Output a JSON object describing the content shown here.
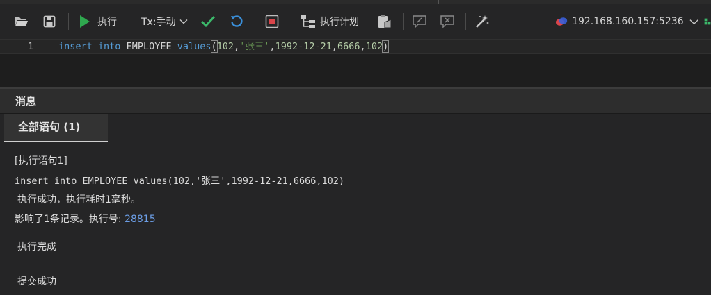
{
  "toolbar": {
    "execute_label": "执行",
    "tx_mode_label": "Tx:手动",
    "exec_plan_label": "执行计划",
    "connection_label": "192.168.160.157:5236"
  },
  "editor": {
    "line_number": "1",
    "tokens": {
      "kw1": "insert",
      "kw2": "into",
      "table": "EMPLOYEE",
      "kw3": "values",
      "lparen": "(",
      "n1": "102",
      "comma1": ",",
      "s1": "'张三'",
      "comma2": ",",
      "n2": "1992-12-21",
      "comma3": ",",
      "n3": "6666",
      "comma4": ",",
      "n4": "102",
      "rparen": ")"
    }
  },
  "messages": {
    "title": "消息",
    "tab_all": "全部语句 (1)",
    "stmt_header": "[执行语句1]",
    "stmt_sql": "insert into EMPLOYEE values(102,'张三',1992-12-21,6666,102)",
    "success_line": "执行成功，执行耗时1毫秒。",
    "affected_prefix": "影响了1条记录。执行号:",
    "exec_number": "28815",
    "exec_done": "执行完成",
    "commit_success": "提交成功"
  },
  "colors": {
    "keyword": "#569cd6",
    "number": "#b5cea8",
    "string": "#6a9955",
    "run_green": "#2fa84f",
    "check_green": "#3bb86a",
    "undo_blue": "#3a8fd9",
    "stop_red": "#d9454a",
    "exec_number": "#6c9ee6"
  }
}
